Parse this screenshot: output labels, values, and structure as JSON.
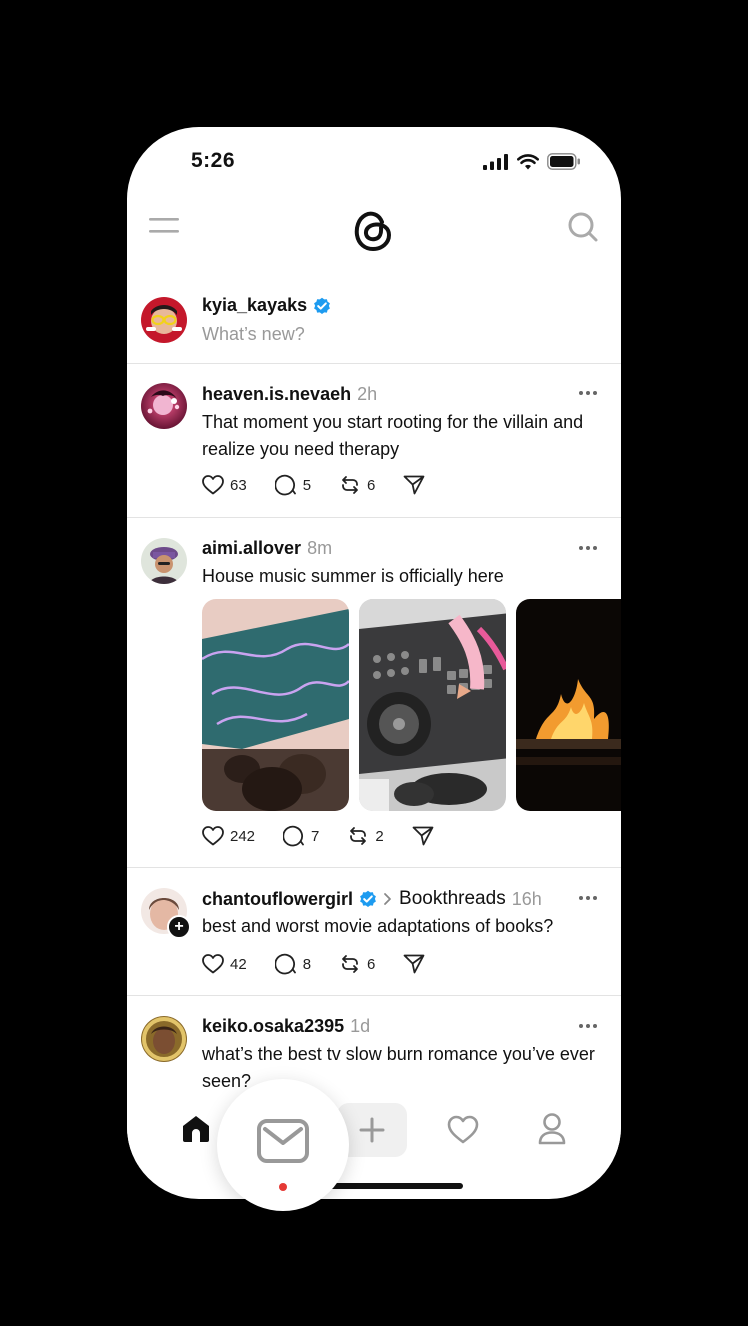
{
  "status": {
    "time": "5:26"
  },
  "composer": {
    "username": "kyia_kayaks",
    "placeholder": "What’s new?"
  },
  "posts": [
    {
      "username": "heaven.is.nevaeh",
      "time": "2h",
      "text": "That moment you start rooting for the villain and realize you need therapy",
      "likes": "63",
      "replies": "5",
      "reposts": "6"
    },
    {
      "username": "aimi.allover",
      "time": "8m",
      "text": "House music summer is officially here",
      "likes": "242",
      "replies": "7",
      "reposts": "2",
      "media": [
        "pool-party-image",
        "dj-controller-image",
        "fire-image"
      ]
    },
    {
      "username": "chantouflowergirl",
      "topic": "Bookthreads",
      "time": "16h",
      "text": "best and worst movie adaptations of books?",
      "likes": "42",
      "replies": "8",
      "reposts": "6"
    },
    {
      "username": "keiko.osaka2395",
      "time": "1d",
      "text": "what’s the best tv slow burn romance you’ve ever seen?"
    }
  ],
  "colors": {
    "verified": "#1d9bf0",
    "notification_dot": "#e53935",
    "muted_text": "#999999"
  },
  "icons": {
    "top_left": "menu-icon",
    "top_center": "threads-logo",
    "top_right": "search-icon",
    "nav": [
      "home-icon",
      "mail-icon",
      "plus-icon",
      "heart-icon",
      "profile-icon"
    ]
  }
}
